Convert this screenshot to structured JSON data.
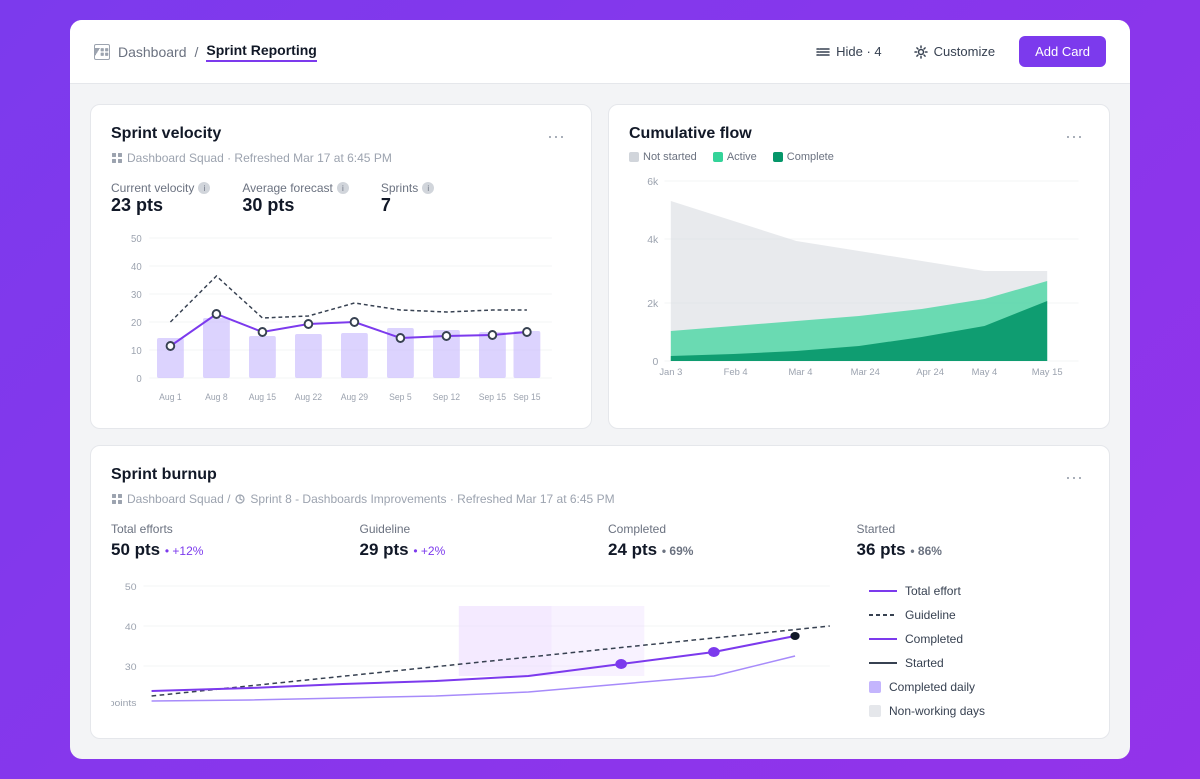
{
  "header": {
    "breadcrumb_home": "Dashboard",
    "breadcrumb_separator": "/",
    "breadcrumb_current": "Sprint Reporting",
    "hide_label": "Hide · 4",
    "customize_label": "Customize",
    "add_card_label": "Add Card"
  },
  "sprint_velocity": {
    "title": "Sprint velocity",
    "meta": "Dashboard Squad · Refreshed Mar 17 at 6:45 PM",
    "current_velocity_label": "Current velocity",
    "current_velocity_value": "23 pts",
    "average_forecast_label": "Average forecast",
    "average_forecast_value": "30 pts",
    "sprints_label": "Sprints",
    "sprints_value": "7",
    "x_labels": [
      "Aug 1",
      "Aug 8",
      "Aug 15",
      "Aug 22",
      "Aug 29",
      "Sep 5",
      "Sep 12",
      "Sep 15",
      "Sep 15"
    ],
    "y_max": 50
  },
  "cumulative_flow": {
    "title": "Cumulative flow",
    "legend": [
      {
        "label": "Not started",
        "color": "#d1d5db"
      },
      {
        "label": "Active",
        "color": "#34d399"
      },
      {
        "label": "Complete",
        "color": "#059669"
      }
    ],
    "x_labels": [
      "Jan 3",
      "Feb 4",
      "Mar 4",
      "Mar 24",
      "Apr 24",
      "May 4",
      "May 15"
    ],
    "y_labels": [
      "0",
      "2k",
      "4k",
      "6k"
    ]
  },
  "sprint_burnup": {
    "title": "Sprint burnup",
    "meta": "Dashboard Squad / Sprint 8 - Dashboards Improvements · Refreshed Mar 17 at 6:45 PM",
    "stats": [
      {
        "label": "Total efforts",
        "value": "50 pts",
        "change": "+12%",
        "positive": true
      },
      {
        "label": "Guideline",
        "value": "29 pts",
        "change": "+2%",
        "positive": true
      },
      {
        "label": "Completed",
        "value": "24 pts",
        "change": "69%",
        "positive": false
      },
      {
        "label": "Started",
        "value": "36 pts",
        "change": "86%",
        "positive": false
      }
    ],
    "legend": [
      {
        "label": "Total effort",
        "type": "solid",
        "color": "#7c3aed"
      },
      {
        "label": "Guideline",
        "type": "dashed",
        "color": "#374151"
      },
      {
        "label": "Completed",
        "type": "solid",
        "color": "#7c3aed"
      },
      {
        "label": "Started",
        "type": "solid",
        "color": "#374151"
      },
      {
        "label": "Completed daily",
        "type": "box",
        "color": "#c4b5fd"
      },
      {
        "label": "Non-working days",
        "type": "box",
        "color": "#e5e7eb"
      }
    ]
  }
}
